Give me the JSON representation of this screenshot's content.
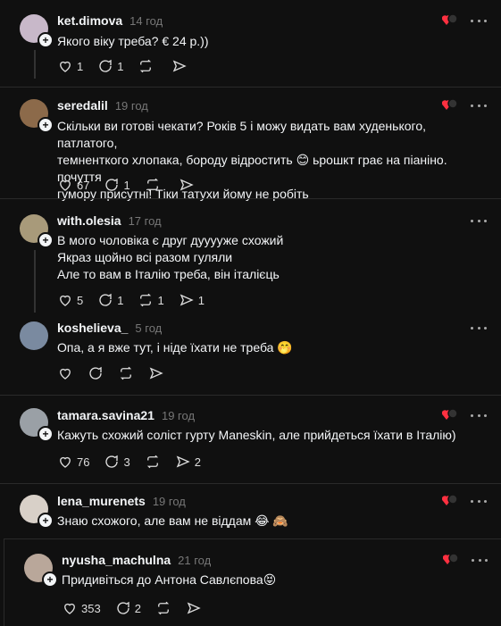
{
  "posts": [
    {
      "username": "ket.dimova",
      "time": "14 год",
      "text": "Якого віку треба? € 24 р.))",
      "likes": "1",
      "replies": "1",
      "reposts": "",
      "avatar_color": "#c8b8c9",
      "liked_by_author": true
    },
    {
      "username": "seredalil",
      "time": "19 год",
      "text": "Скільки ви готові чекати? Років 5 і можу видать вам худенького, патлатого,\nтемненткого хлопака, бороду відростить 😊 ьрошкт грає на піаніно. почуття\nгумору присутні! Тіки татухи йому не робіть",
      "likes": "67",
      "replies": "1",
      "reposts": "",
      "avatar_color": "#8c6a4a",
      "liked_by_author": true
    },
    {
      "username": "with.olesia",
      "time": "17 год",
      "text": "В мого чоловіка є друг дууууже схожий\nЯкраз щойно всі разом гуляли\nАле то вам в Італію треба, він італієць",
      "likes": "5",
      "replies": "1",
      "reposts": "1",
      "avatar_color": "#a89a7a",
      "liked_by_author": false
    },
    {
      "username": "koshelieva_",
      "time": "5 год",
      "text": "Опа, а я вже тут, і ніде їхати не треба 🤭",
      "likes": "",
      "replies": "",
      "reposts": "",
      "avatar_color": "#7a8aa0",
      "liked_by_author": false
    },
    {
      "username": "tamara.savina21",
      "time": "19 год",
      "text": "Кажуть схожий соліст гурту Maneskin, але прийдеться їхати в Італію)",
      "likes": "76",
      "replies": "3",
      "reposts": "2",
      "avatar_color": "#9aa0a6",
      "liked_by_author": true
    },
    {
      "username": "lena_murenets",
      "time": "19 год",
      "text": "Знаю схожого, але вам не віддам 😂 🙈",
      "likes": "",
      "replies": "",
      "reposts": "",
      "avatar_color": "#d8d0c8",
      "liked_by_author": true
    },
    {
      "username": "nyusha_machulna",
      "time": "21 год",
      "text": "Придивіться до Антона Савлєпова😝",
      "likes": "353",
      "replies": "2",
      "reposts": "",
      "avatar_color": "#b9a79a",
      "liked_by_author": true
    }
  ],
  "colors": {
    "accent_like": "#ff3040",
    "background": "#101010",
    "muted": "#777777"
  },
  "icons": {
    "like": "heart-icon",
    "reply": "reply-icon",
    "repost": "repost-icon",
    "share": "share-icon",
    "more": "more-dots-icon",
    "follow": "plus-icon"
  }
}
